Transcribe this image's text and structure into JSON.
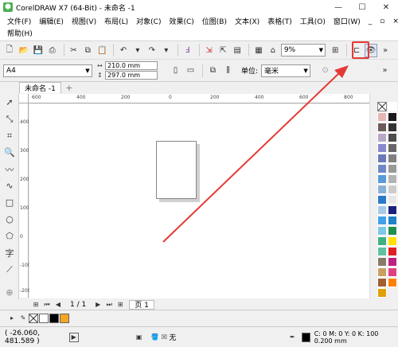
{
  "window": {
    "title": "CorelDRAW X7 (64-Bit) - 未命名 -1",
    "minimize": "—",
    "maximize": "☐",
    "close": "✕"
  },
  "menu": {
    "row1": [
      "文件(F)",
      "编辑(E)",
      "视图(V)",
      "布局(L)",
      "对象(C)",
      "效果(C)",
      "位图(B)",
      "文本(X)",
      "表格(T)",
      "工具(O)",
      "窗口(W)"
    ],
    "row2": [
      "帮助(H)"
    ],
    "controls": [
      "_",
      "▫",
      "×"
    ]
  },
  "toolbar1": {
    "zoom_value": "9%"
  },
  "property_bar": {
    "page_size": "A4",
    "width": "210.0 mm",
    "height": "297.0 mm",
    "unit_label": "单位:",
    "unit_value": "毫米"
  },
  "tabs": {
    "document": "未命名 -1",
    "add": "+"
  },
  "ruler": {
    "h_labels": [
      "600",
      "400",
      "200",
      "0",
      "200",
      "400",
      "600",
      "800"
    ],
    "v_labels": [
      "400",
      "300",
      "200",
      "100",
      "0",
      "-100",
      "-200"
    ]
  },
  "page_nav": {
    "position": "1 / 1",
    "page_tab": "页 1"
  },
  "status": {
    "coords": "( -26.060, 481.589 )",
    "fill_label": "无",
    "outline_info": "C: 0 M: 0 Y: 0 K: 100  0.200 mm"
  },
  "colors": {
    "annotation": "#e53935",
    "palette": [
      "#ffffff",
      "#e8b4b4",
      "#1a1a1a",
      "#6b5b5b",
      "#333333",
      "#b8a8c8",
      "#4d4d4d",
      "#8888cc",
      "#666666",
      "#6a7ab8",
      "#808080",
      "#7088c8",
      "#999999",
      "#5a9ad8",
      "#b3b3b3",
      "#8ab0d8",
      "#cccccc",
      "#2a7ac8",
      "#e6e6e6",
      "#a8c8e8",
      "#1a2080",
      "#40a0e8",
      "#2080c8",
      "#80c8e8",
      "#209050",
      "#40b080",
      "#ffe000",
      "#60c0a0",
      "#e02020",
      "#8a7a6a",
      "#c02080",
      "#c8a060",
      "#e04080",
      "#a06030",
      "#ff8000",
      "#e0a000"
    ]
  }
}
